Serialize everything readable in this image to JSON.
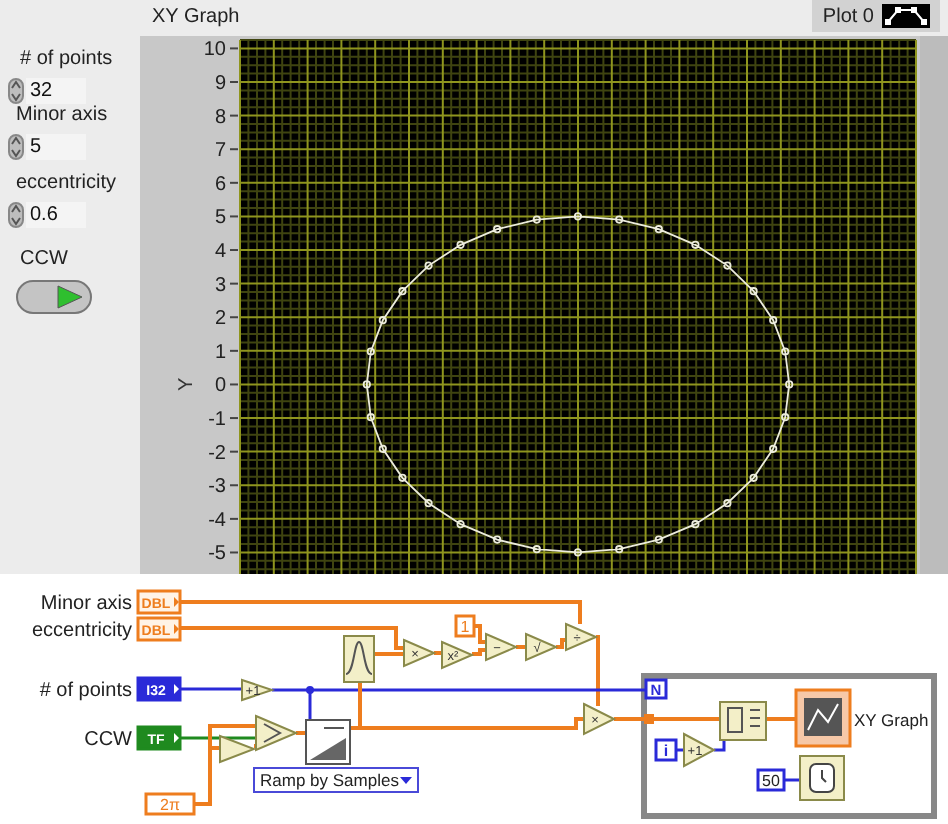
{
  "front_panel": {
    "controls": [
      {
        "kind": "numeric",
        "label": "# of points",
        "value": "32"
      },
      {
        "kind": "numeric",
        "label": "Minor axis",
        "value": "5"
      },
      {
        "kind": "numeric",
        "label": "eccentricity",
        "value": "0.6"
      },
      {
        "kind": "boolean",
        "label": "CCW",
        "on": true
      }
    ],
    "graph": {
      "label": "XY Graph",
      "legend": "Plot 0",
      "y_axis_label": "Y",
      "y_ticks": [
        "10",
        "9",
        "8",
        "7",
        "6",
        "5",
        "4",
        "3",
        "2",
        "1",
        "0",
        "-1",
        "-2",
        "-3",
        "-4",
        "-5"
      ]
    }
  },
  "block_diagram": {
    "terminals": [
      {
        "label": "Minor axis",
        "type": "DBL",
        "kind": "dbl"
      },
      {
        "label": "eccentricity",
        "type": "DBL",
        "kind": "dbl"
      },
      {
        "label": "# of points",
        "type": "I32",
        "kind": "i32"
      },
      {
        "label": "CCW",
        "type": "TF",
        "kind": "bool"
      }
    ],
    "primitives": [
      {
        "symbol": "+1"
      },
      {
        "symbol": "×"
      },
      {
        "symbol": "x²"
      },
      {
        "symbol": "−"
      },
      {
        "symbol": "√"
      },
      {
        "symbol": "÷"
      },
      {
        "symbol": "×"
      },
      {
        "symbol": "+1"
      }
    ],
    "constants": [
      {
        "value": "1",
        "kind": "dbl"
      },
      {
        "value": "2π",
        "kind": "dbl"
      },
      {
        "value": "50",
        "kind": "i32"
      }
    ],
    "ramp_mode": "Ramp by Samples",
    "loop": {
      "count": "N",
      "index": "i"
    },
    "graph_terminal": "XY Graph"
  }
}
